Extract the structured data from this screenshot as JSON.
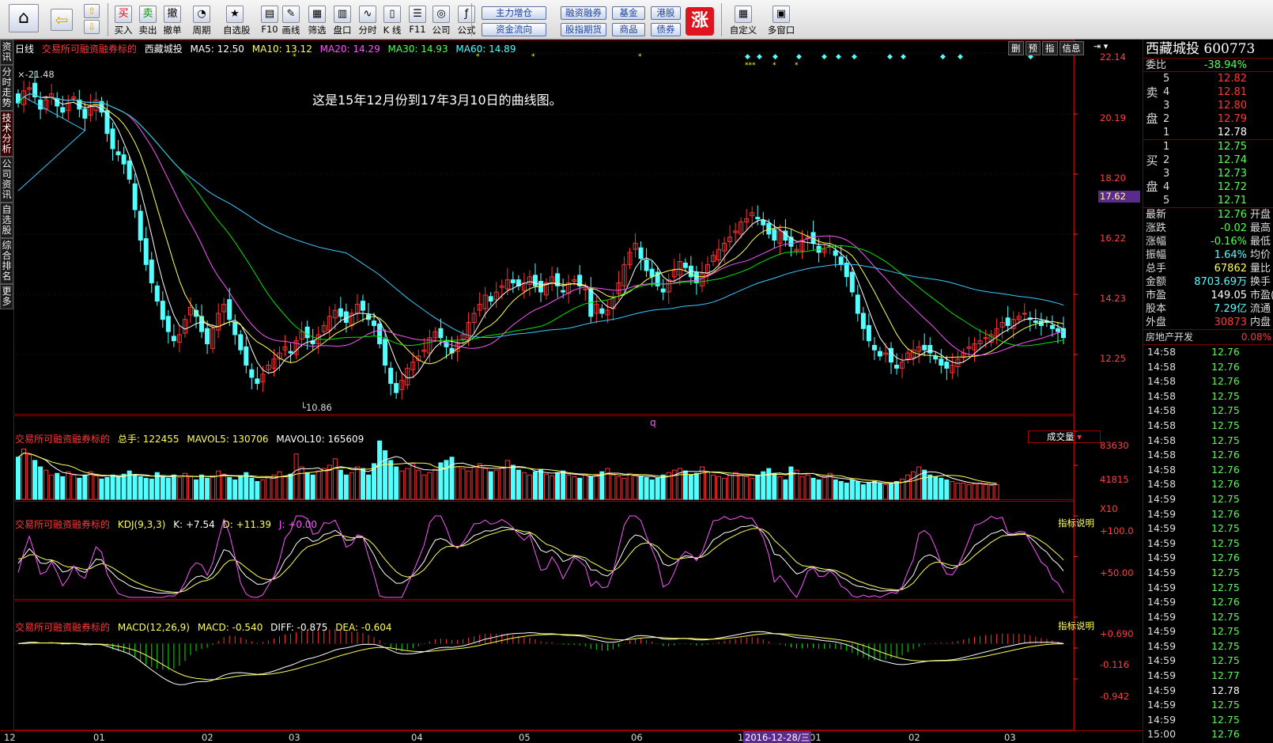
{
  "toolbar": {
    "buttons": [
      "买入",
      "卖出",
      "撤单",
      "周期",
      "自选股",
      "F10",
      "画线",
      "筛选",
      "盘口",
      "分时",
      "K 线",
      "F11",
      "公司",
      "公式"
    ],
    "icon_glyphs": [
      "买",
      "卖",
      "撤",
      "◔",
      "★",
      "▤",
      "✎",
      "▦",
      "▥",
      "∿",
      "▯",
      "☰",
      "◎",
      "ƒ"
    ],
    "pills": [
      "主力增仓",
      "资金流向",
      "融资融券",
      "股指期货",
      "基金",
      "商品",
      "港股",
      "债券"
    ],
    "big_button": "涨",
    "right_buttons": [
      "自定义",
      "多窗口"
    ],
    "home_icon": "home-icon",
    "back_icon": "back-arrow-icon"
  },
  "left_tabs": [
    "资讯",
    "分时走势",
    "技术分析",
    "公司资讯",
    "自选股",
    "综合排名",
    "更多"
  ],
  "chart_header": {
    "period": "日线",
    "subtitle": "交易所可融资融券标的",
    "stock": "西藏城投",
    "ma5": "MA5: 12.50",
    "ma10": "MA10: 13.12",
    "ma20": "MA20: 14.29",
    "ma30": "MA30: 14.93",
    "ma60": "MA60: 14.89",
    "top_buttons": [
      "删",
      "预",
      "指",
      "信息"
    ],
    "high_label": "21.48",
    "low_label": "10.86",
    "annotation": "这是15年12月份到17年3月10日的曲线图。",
    "q_marker": "q",
    "current_price_tag": "17.62"
  },
  "price_axis": [
    "22.14",
    "20.19",
    "18.20",
    "16.22",
    "14.23",
    "12.25"
  ],
  "volume_header": {
    "subtitle": "交易所可融资融券标的",
    "total": "总手: 122455",
    "mavol5": "MAVOL5: 130706",
    "mavol10": "MAVOL10: 165609",
    "dropdown": "成交量",
    "axis": [
      "83630",
      "41815",
      "X10"
    ]
  },
  "kdj_header": {
    "subtitle": "交易所可融资融券标的",
    "name": "KDJ(9,3,3)",
    "k": "K: +7.54",
    "d": "D: +11.39",
    "j": "J: +0.00",
    "help": "指标说明",
    "axis": [
      "+100.0",
      "+50.00"
    ]
  },
  "macd_header": {
    "subtitle": "交易所可融资融券标的",
    "name": "MACD(12,26,9)",
    "macd": "MACD: -0.540",
    "diff": "DIFF: -0.875",
    "dea": "DEA: -0.604",
    "help": "指标说明",
    "axis": [
      "+0.690",
      "-0.116",
      "-0.942"
    ]
  },
  "x_axis": {
    "labels": [
      "12",
      "01",
      "02",
      "03",
      "04",
      "05",
      "06",
      "12",
      "01",
      "02",
      "03"
    ],
    "cursor_date": "2016-12-28/三"
  },
  "right_panel": {
    "title": "西藏城投 600773",
    "weibi": {
      "label": "委比",
      "value": "-38.94%"
    },
    "sell_side": "卖盘",
    "buy_side": "买盘",
    "asks": [
      {
        "lvl": "5",
        "price": "12.82"
      },
      {
        "lvl": "4",
        "price": "12.81"
      },
      {
        "lvl": "3",
        "price": "12.80"
      },
      {
        "lvl": "2",
        "price": "12.79"
      },
      {
        "lvl": "1",
        "price": "12.78"
      }
    ],
    "bids": [
      {
        "lvl": "1",
        "price": "12.75"
      },
      {
        "lvl": "2",
        "price": "12.74"
      },
      {
        "lvl": "3",
        "price": "12.73"
      },
      {
        "lvl": "4",
        "price": "12.72"
      },
      {
        "lvl": "5",
        "price": "12.71"
      }
    ],
    "quote": [
      {
        "k": "最新",
        "v": "12.76",
        "c": "green",
        "k2": "开盘"
      },
      {
        "k": "涨跌",
        "v": "-0.02",
        "c": "green",
        "k2": "最高"
      },
      {
        "k": "涨幅",
        "v": "-0.16%",
        "c": "green",
        "k2": "最低"
      },
      {
        "k": "振幅",
        "v": "1.64%",
        "c": "cyan",
        "k2": "均价"
      },
      {
        "k": "总手",
        "v": "67862",
        "c": "yellow",
        "k2": "量比"
      },
      {
        "k": "金额",
        "v": "8703.69万",
        "c": "cyan",
        "k2": "换手"
      },
      {
        "k": "市盈",
        "v": "149.05",
        "c": "white",
        "k2": "市盈("
      },
      {
        "k": "股本",
        "v": "7.29亿",
        "c": "cyan",
        "k2": "流通"
      },
      {
        "k": "外盘",
        "v": "30873",
        "c": "red",
        "k2": "内盘"
      }
    ],
    "sector": {
      "name": "房地产开发",
      "change": "0.08%"
    },
    "ticks": [
      {
        "t": "14:58",
        "p": "12.76"
      },
      {
        "t": "14:58",
        "p": "12.76"
      },
      {
        "t": "14:58",
        "p": "12.76"
      },
      {
        "t": "14:58",
        "p": "12.75"
      },
      {
        "t": "14:58",
        "p": "12.75"
      },
      {
        "t": "14:58",
        "p": "12.75"
      },
      {
        "t": "14:58",
        "p": "12.75"
      },
      {
        "t": "14:58",
        "p": "12.76"
      },
      {
        "t": "14:58",
        "p": "12.76"
      },
      {
        "t": "14:58",
        "p": "12.76"
      },
      {
        "t": "14:59",
        "p": "12.75"
      },
      {
        "t": "14:59",
        "p": "12.76"
      },
      {
        "t": "14:59",
        "p": "12.75"
      },
      {
        "t": "14:59",
        "p": "12.75"
      },
      {
        "t": "14:59",
        "p": "12.76"
      },
      {
        "t": "14:59",
        "p": "12.75"
      },
      {
        "t": "14:59",
        "p": "12.75"
      },
      {
        "t": "14:59",
        "p": "12.76"
      },
      {
        "t": "14:59",
        "p": "12.75"
      },
      {
        "t": "14:59",
        "p": "12.75"
      },
      {
        "t": "14:59",
        "p": "12.75"
      },
      {
        "t": "14:59",
        "p": "12.75"
      },
      {
        "t": "14:59",
        "p": "12.77"
      },
      {
        "t": "14:59",
        "p": "12.78"
      },
      {
        "t": "14:59",
        "p": "12.75"
      },
      {
        "t": "14:59",
        "p": "12.75"
      },
      {
        "t": "15:00",
        "p": "12.76"
      }
    ]
  },
  "colors": {
    "up": "#ff3232",
    "down": "#54ffff",
    "ma5": "#ffffff",
    "ma10": "#ffff54",
    "ma20": "#ff54ff",
    "ma30": "#00e600",
    "ma60": "#3cc8ff",
    "grid": "#8b0000"
  },
  "series": {
    "close": [
      20.5,
      20.9,
      21.0,
      20.7,
      20.3,
      20.6,
      20.8,
      20.4,
      20.2,
      20.5,
      20.7,
      20.3,
      20.0,
      20.4,
      20.6,
      20.2,
      19.5,
      19.0,
      18.8,
      18.5,
      18.0,
      17.0,
      16.0,
      15.2,
      14.6,
      14.0,
      13.4,
      13.0,
      12.7,
      12.9,
      13.4,
      13.8,
      13.5,
      13.0,
      12.6,
      13.1,
      13.6,
      13.9,
      13.4,
      12.9,
      12.4,
      11.9,
      11.5,
      11.3,
      11.6,
      11.9,
      12.1,
      12.3,
      12.5,
      12.3,
      12.7,
      13.0,
      12.8,
      12.6,
      12.9,
      13.2,
      13.5,
      13.7,
      13.5,
      13.3,
      13.6,
      13.9,
      13.7,
      13.4,
      13.2,
      12.6,
      11.9,
      11.3,
      11.0,
      11.4,
      11.8,
      12.0,
      12.2,
      12.4,
      12.8,
      13.0,
      12.8,
      12.5,
      12.3,
      12.6,
      12.9,
      13.3,
      13.6,
      13.9,
      14.2,
      14.0,
      14.3,
      14.5,
      14.7,
      14.6,
      14.5,
      14.6,
      14.8,
      14.5,
      14.3,
      14.6,
      14.8,
      14.5,
      14.3,
      14.6,
      14.7,
      14.5,
      14.4,
      13.5,
      13.9,
      13.6,
      13.7,
      14.1,
      14.6,
      15.2,
      15.6,
      15.9,
      15.4,
      15.0,
      14.8,
      14.5,
      14.3,
      14.7,
      15.0,
      15.3,
      15.1,
      14.8,
      14.6,
      14.9,
      15.2,
      15.5,
      15.7,
      15.9,
      16.1,
      16.3,
      16.6,
      16.7,
      16.9,
      16.7,
      16.5,
      16.2,
      16.0,
      16.3,
      16.0,
      15.8,
      15.7,
      16.0,
      16.1,
      15.9,
      15.6,
      15.7,
      15.8,
      15.5,
      15.2,
      14.8,
      14.3,
      13.6,
      13.1,
      12.7,
      12.4,
      12.2,
      12.3,
      12.0,
      11.8,
      12.0,
      12.3,
      12.4,
      12.5,
      12.4,
      12.3,
      12.1,
      11.9,
      11.8,
      11.9,
      12.1,
      12.3,
      12.5,
      12.6,
      12.7,
      12.8,
      12.9,
      13.1,
      13.3,
      13.2,
      13.4,
      13.5,
      13.6,
      13.4,
      13.3,
      13.2,
      13.3,
      13.1,
      13.0,
      12.8
    ],
    "volume": [
      52,
      62,
      55,
      48,
      40,
      36,
      30,
      32,
      28,
      34,
      30,
      26,
      30,
      34,
      29,
      25,
      27,
      30,
      28,
      31,
      35,
      30,
      28,
      26,
      25,
      33,
      28,
      26,
      30,
      27,
      32,
      28,
      24,
      30,
      26,
      29,
      35,
      31,
      27,
      24,
      29,
      33,
      26,
      22,
      24,
      28,
      30,
      34,
      28,
      31,
      56,
      40,
      33,
      30,
      35,
      38,
      42,
      50,
      36,
      30,
      33,
      40,
      38,
      30,
      44,
      72,
      60,
      48,
      40,
      35,
      38,
      44,
      36,
      30,
      33,
      37,
      45,
      48,
      52,
      40,
      38,
      35,
      40,
      44,
      38,
      34,
      36,
      40,
      48,
      42,
      36,
      33,
      30,
      34,
      37,
      31,
      29,
      33,
      35,
      30,
      28,
      26,
      30,
      28,
      31,
      34,
      38,
      30,
      28,
      26,
      32,
      30,
      28,
      27,
      24,
      26,
      30,
      33,
      36,
      38,
      35,
      30,
      32,
      40,
      34,
      30,
      28,
      26,
      30,
      33,
      30,
      28,
      26,
      30,
      34,
      38,
      32,
      28,
      24,
      40,
      36,
      28,
      30,
      26,
      24,
      28,
      32,
      24,
      22,
      20,
      24,
      22,
      18,
      20,
      22,
      20,
      18,
      19,
      22,
      25,
      30,
      34,
      40,
      36,
      30,
      28,
      26,
      24,
      22,
      20,
      20,
      18,
      19,
      20,
      18,
      17,
      18
    ]
  }
}
